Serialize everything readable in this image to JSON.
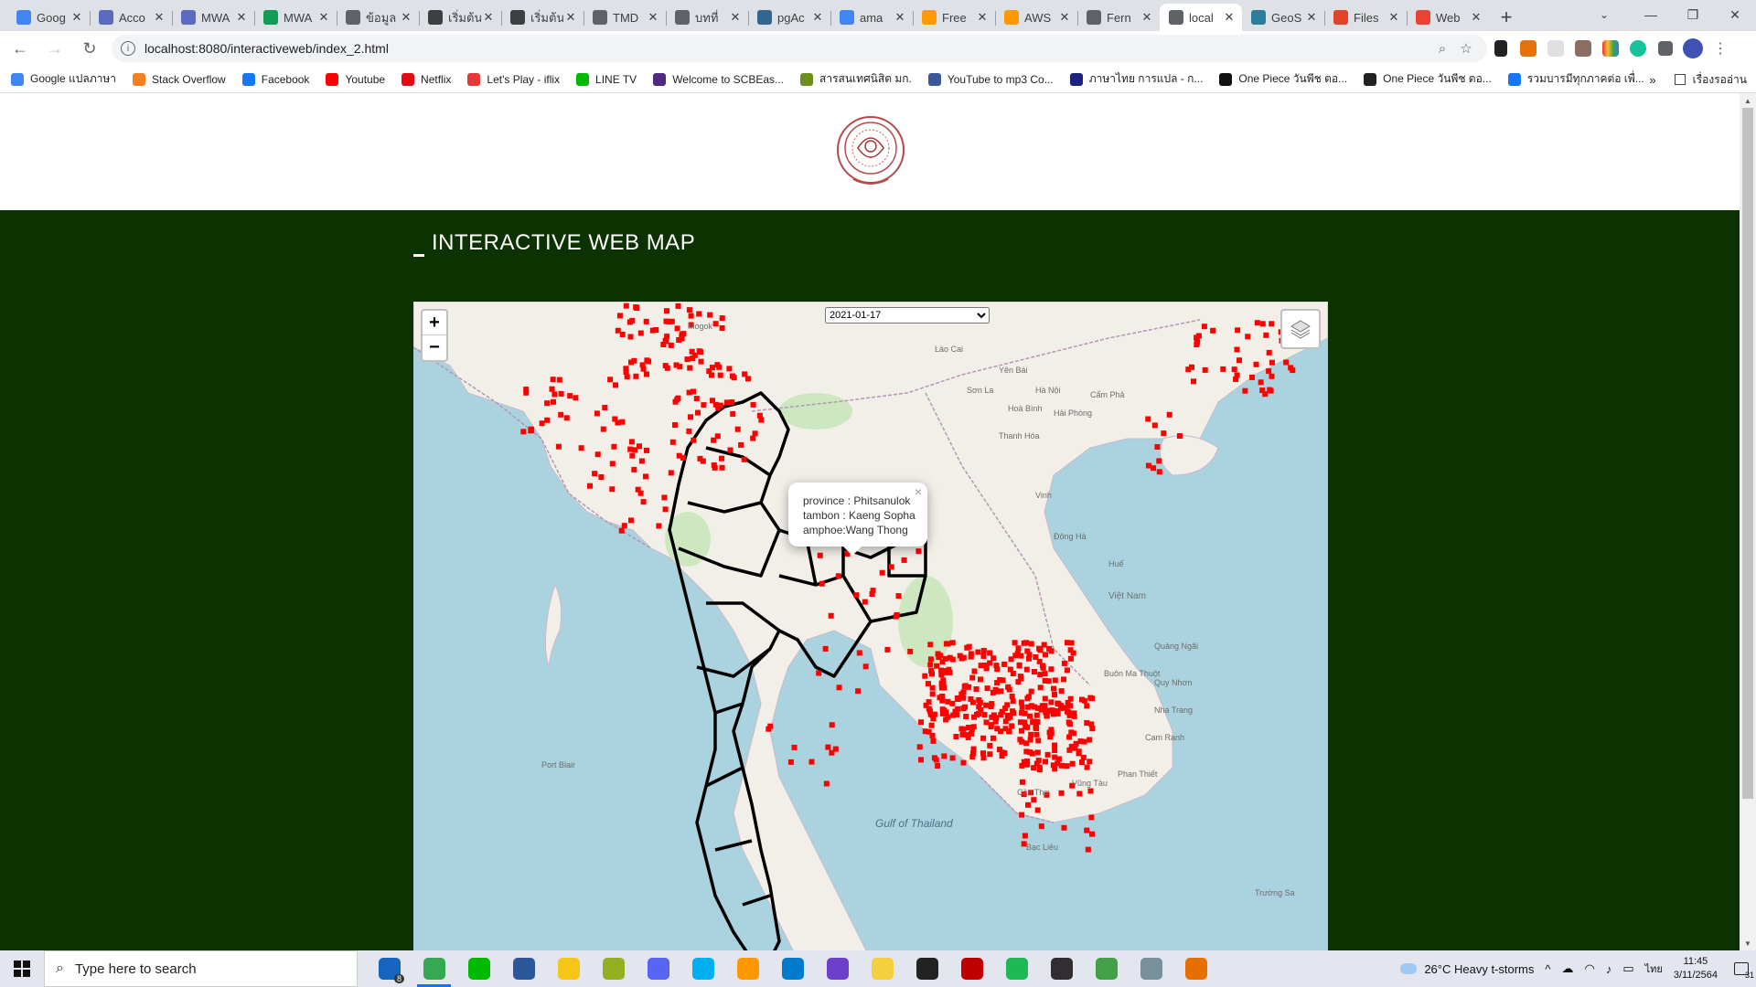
{
  "browser": {
    "tabs": [
      {
        "title": "Goog",
        "icon": "google-docs-icon",
        "color": "#4285f4",
        "active": false
      },
      {
        "title": "Acco",
        "icon": "account-icon",
        "color": "#5c6bc0",
        "active": false
      },
      {
        "title": "MWA",
        "icon": "messenger-icon",
        "color": "#5c6bc0",
        "active": false
      },
      {
        "title": "MWA",
        "icon": "sheets-icon",
        "color": "#0f9d58",
        "active": false
      },
      {
        "title": "ข้อมูล",
        "icon": "globe-icon",
        "color": "#5f6368",
        "active": false
      },
      {
        "title": "เริ่มต้น",
        "icon": "book-icon",
        "color": "#3c4043",
        "active": false
      },
      {
        "title": "เริ่มต้น",
        "icon": "book-icon",
        "color": "#3c4043",
        "active": false
      },
      {
        "title": "TMD",
        "icon": "globe-icon",
        "color": "#5f6368",
        "active": false
      },
      {
        "title": "บทที่",
        "icon": "globe-icon",
        "color": "#5f6368",
        "active": false
      },
      {
        "title": "pgAc",
        "icon": "pg-icon",
        "color": "#336791",
        "active": false
      },
      {
        "title": "ama",
        "icon": "google-icon",
        "color": "#4285f4",
        "active": false
      },
      {
        "title": "Free",
        "icon": "aws-icon",
        "color": "#ff9900",
        "active": false
      },
      {
        "title": "AWS",
        "icon": "aws-icon",
        "color": "#ff9900",
        "active": false
      },
      {
        "title": "Fern",
        "icon": "globe-icon",
        "color": "#5f6368",
        "active": false
      },
      {
        "title": "local",
        "icon": "map-icon",
        "color": "#5f6368",
        "active": true
      },
      {
        "title": "GeoS",
        "icon": "geoserver-icon",
        "color": "#2e7d9a",
        "active": false
      },
      {
        "title": "Files",
        "icon": "gitlab-icon",
        "color": "#e24329",
        "active": false
      },
      {
        "title": "Web",
        "icon": "gmail-icon",
        "color": "#ea4335",
        "active": false
      }
    ],
    "url": "localhost:8080/interactiveweb/index_2.html",
    "bookmarks": [
      {
        "label": "Google แปลภาษา",
        "color": "#4285f4"
      },
      {
        "label": "Stack Overflow",
        "color": "#f48024"
      },
      {
        "label": "Facebook",
        "color": "#1877f2"
      },
      {
        "label": "Youtube",
        "color": "#ff0000"
      },
      {
        "label": "Netflix",
        "color": "#e50914"
      },
      {
        "label": "Let's Play - iflix",
        "color": "#e53935"
      },
      {
        "label": "LINE TV",
        "color": "#00b900"
      },
      {
        "label": "Welcome to SCBEas...",
        "color": "#4e2a84"
      },
      {
        "label": "สารสนเทศนิสิต มก.",
        "color": "#6d8f1e"
      },
      {
        "label": "YouTube to mp3 Co...",
        "color": "#3b5998"
      },
      {
        "label": "ภาษาไทย การแปล - ก...",
        "color": "#1a237e"
      },
      {
        "label": "One Piece วันพีช ตอ...",
        "color": "#111111"
      },
      {
        "label": "One Piece วันพีช ตอ...",
        "color": "#222222"
      },
      {
        "label": "รวมบารมีทุกภาคต่อ เพื่...",
        "color": "#1877f2"
      }
    ],
    "reading_list": "เรื่องรออ่าน"
  },
  "page": {
    "title": "INTERACTIVE WEB MAP",
    "date_selected": "2021-01-17",
    "popup": {
      "province": "province : Phitsanulok",
      "tambon": "tambon : Kaeng Sopha",
      "amphoe": "amphoe:Wang Thong"
    },
    "zoom_in": "+",
    "zoom_out": "−",
    "popup_close": "×",
    "map_labels": [
      {
        "text": "Gulf of Thailand"
      },
      {
        "text": "Hà Nội"
      },
      {
        "text": "Hải Phòng"
      },
      {
        "text": "Việt Nam"
      },
      {
        "text": "Port Blair"
      },
      {
        "text": "Mogok"
      },
      {
        "text": "Đông Hà"
      },
      {
        "text": "Huế"
      },
      {
        "text": "Quảng Ngãi"
      },
      {
        "text": "Quy Nhơn"
      },
      {
        "text": "Nha Trang"
      },
      {
        "text": "Buôn Ma Thuột"
      },
      {
        "text": "Cam Ranh"
      },
      {
        "text": "Phan Thiết"
      },
      {
        "text": "Cần Thơ"
      },
      {
        "text": "Vũng Tàu"
      },
      {
        "text": "Bạc Liêu"
      },
      {
        "text": "Thanh Hóa"
      },
      {
        "text": "Vinh"
      },
      {
        "text": "Sơn La"
      },
      {
        "text": "Cẩm Phả"
      },
      {
        "text": "Yên Bái"
      },
      {
        "text": "Lào Cai"
      },
      {
        "text": "Hoà Bình"
      },
      {
        "text": "Trường Sa"
      }
    ]
  },
  "taskbar": {
    "search_placeholder": "Type here to search",
    "apps": [
      {
        "name": "mail-app",
        "color": "#1565c0"
      },
      {
        "name": "chrome-app",
        "color": "#34a853"
      },
      {
        "name": "line-app",
        "color": "#00b900"
      },
      {
        "name": "word-app",
        "color": "#2b579a"
      },
      {
        "name": "file-explorer-app",
        "color": "#f5c518"
      },
      {
        "name": "qgis-app",
        "color": "#93b023"
      },
      {
        "name": "discord-app",
        "color": "#5865f2"
      },
      {
        "name": "skype-app",
        "color": "#00aff0"
      },
      {
        "name": "sublime-app",
        "color": "#ff9800"
      },
      {
        "name": "vscode-app",
        "color": "#007acc"
      },
      {
        "name": "github-app",
        "color": "#6e40c9"
      },
      {
        "name": "sticky-notes-app",
        "color": "#f4d03f"
      },
      {
        "name": "terminal-app",
        "color": "#222222"
      },
      {
        "name": "filezilla-app",
        "color": "#bf0000"
      },
      {
        "name": "spotify-app",
        "color": "#1db954"
      },
      {
        "name": "obs-app",
        "color": "#302e31"
      },
      {
        "name": "node-app",
        "color": "#43a047"
      },
      {
        "name": "notepad-app",
        "color": "#78909c"
      },
      {
        "name": "java-app",
        "color": "#e76f00"
      }
    ],
    "weather": "26°C  Heavy t-storms",
    "language": "ไทย",
    "time": "11:45",
    "date": "3/11/2564",
    "notifications": "31",
    "mail_badge": "8"
  }
}
